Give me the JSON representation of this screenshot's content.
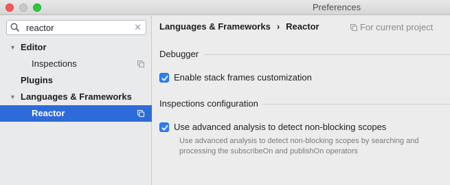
{
  "window": {
    "title": "Preferences"
  },
  "search": {
    "value": "reactor",
    "placeholder": ""
  },
  "sidebar": {
    "items": [
      {
        "label": "Editor",
        "expanded": true
      },
      {
        "label": "Inspections"
      },
      {
        "label": "Plugins"
      },
      {
        "label": "Languages & Frameworks",
        "expanded": true
      },
      {
        "label": "Reactor",
        "selected": true
      }
    ]
  },
  "breadcrumb": {
    "parent": "Languages & Frameworks",
    "separator": "›",
    "current": "Reactor"
  },
  "scope": {
    "label": "For current project"
  },
  "debugger": {
    "title": "Debugger",
    "enable_stack_frames": {
      "label": "Enable stack frames customization",
      "checked": true
    }
  },
  "inspections_config": {
    "title": "Inspections configuration",
    "advanced_analysis": {
      "label": "Use advanced analysis to detect non-blocking scopes",
      "checked": true,
      "description_line1": "Use advanced analysis to detect non-blocking scopes by searching and",
      "description_line2": "processing the subscribeOn and publishOn operators"
    }
  },
  "colors": {
    "selection": "#2d6bd8",
    "checkbox": "#2d7ff6"
  }
}
